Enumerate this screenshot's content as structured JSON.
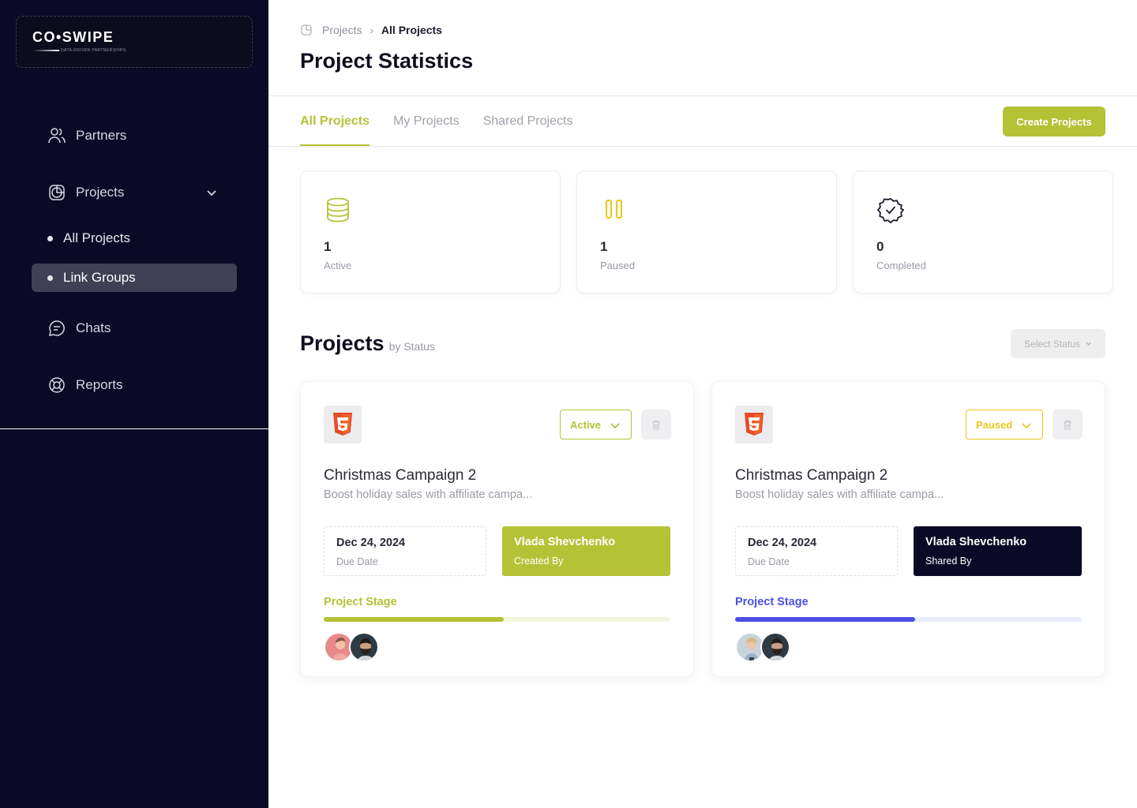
{
  "brand": {
    "name": "CO•SWIPE",
    "tagline": "DATA-DRIVEN PARTNERSHIPS"
  },
  "sidebar": {
    "items": [
      {
        "label": "Partners",
        "icon": "users-icon"
      },
      {
        "label": "Projects",
        "icon": "projects-icon"
      },
      {
        "label": "Chats",
        "icon": "chat-icon"
      },
      {
        "label": "Reports",
        "icon": "lifebuoy-icon"
      }
    ],
    "subitems": [
      {
        "label": "All Projects"
      },
      {
        "label": "Link Groups",
        "active": true
      }
    ]
  },
  "breadcrumb": {
    "parent": "Projects",
    "current": "All Projects"
  },
  "header": {
    "title": "Project Statistics"
  },
  "tabs": [
    {
      "label": "All Projects",
      "active": true
    },
    {
      "label": "My Projects"
    },
    {
      "label": "Shared Projects"
    }
  ],
  "create_button": "Create Projects",
  "stats": [
    {
      "value": "1",
      "label": "Active",
      "icon": "database-icon",
      "color": "#b4c236"
    },
    {
      "value": "1",
      "label": "Paused",
      "icon": "pause-icon",
      "color": "#e6c81c"
    },
    {
      "value": "0",
      "label": "Completed",
      "icon": "verified-badge-icon",
      "color": "#1a1a2a"
    }
  ],
  "projects_section": {
    "title": "Projects",
    "subtitle": "by Status",
    "select_placeholder": "Select Status"
  },
  "cards": [
    {
      "status": "Active",
      "status_color": "#b4c236",
      "title": "Christmas Campaign 2",
      "description": "Boost holiday sales with affiliate campa...",
      "due_date": "Dec 24, 2024",
      "due_label": "Due Date",
      "person": "Vlada Shevchenko",
      "person_role": "Created By",
      "person_bg": "#b4c236",
      "stage_label": "Project Stage",
      "stage_color": "#b4c236",
      "stage_track": "#f4f6e2",
      "progress": 0.52
    },
    {
      "status": "Paused",
      "status_color": "#e6c81c",
      "title": "Christmas Campaign 2",
      "description": "Boost holiday sales with affiliate campa...",
      "due_date": "Dec 24, 2024",
      "due_label": "Due Date",
      "person": "Vlada Shevchenko",
      "person_role": "Shared By",
      "person_bg": "#0a0a26",
      "stage_label": "Project Stage",
      "stage_color": "#4b4fe8",
      "stage_track": "#e8ecfb",
      "progress": 0.52
    }
  ]
}
